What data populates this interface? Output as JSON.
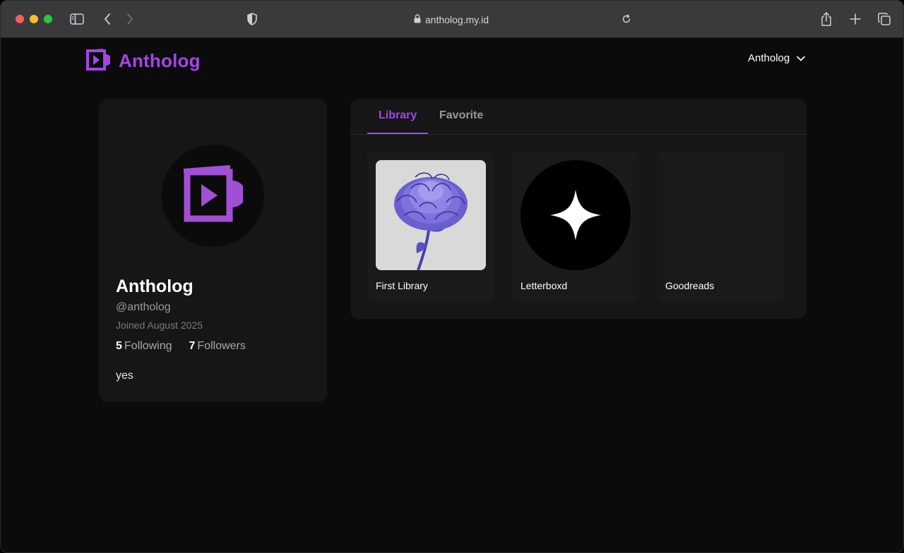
{
  "browser": {
    "url": "antholog.my.id"
  },
  "header": {
    "brand": "Antholog",
    "user_menu_label": "Antholog"
  },
  "profile": {
    "name": "Antholog",
    "handle": "@antholog",
    "joined": "Joined August 2025",
    "following_count": "5",
    "following_label": "Following",
    "followers_count": "7",
    "followers_label": "Followers",
    "bio": "yes"
  },
  "tabs": [
    {
      "label": "Library",
      "active": true
    },
    {
      "label": "Favorite",
      "active": false
    }
  ],
  "libraries": [
    {
      "label": "First Library",
      "thumb": "flower-drawing"
    },
    {
      "label": "Letterboxd",
      "thumb": "sparkle-icon"
    },
    {
      "label": "Goodreads",
      "thumb": "empty"
    }
  ],
  "colors": {
    "accent": "#a445e6",
    "background": "#0b0b0c",
    "card": "#161617"
  }
}
